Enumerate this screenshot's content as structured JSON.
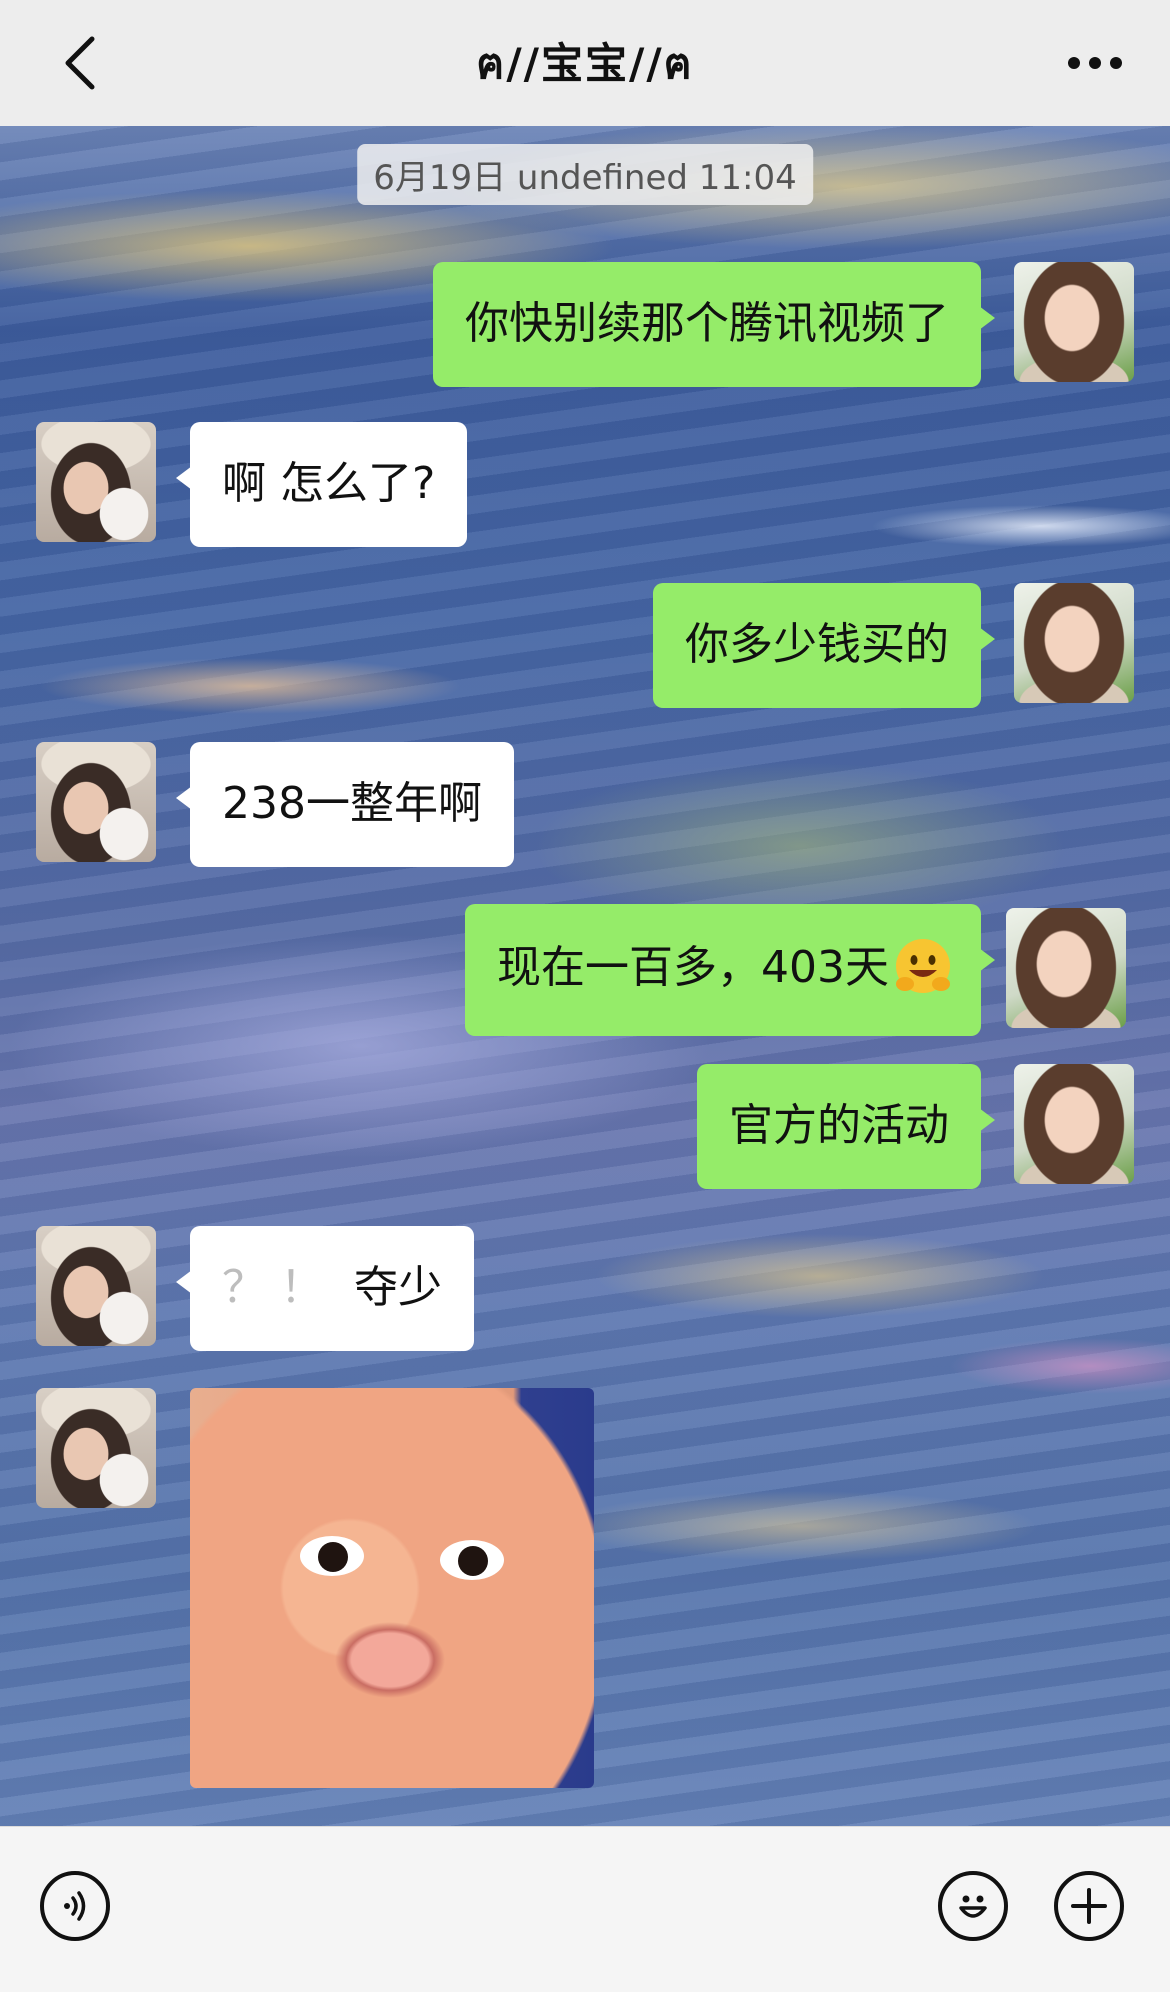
{
  "header": {
    "title": "ฅ//宝宝//ฅ",
    "back_icon": "chevron-left-icon",
    "more_icon": "more-dots-icon"
  },
  "chat": {
    "timestamp": "6月19日 undefined 11:04",
    "messages": [
      {
        "side": "right",
        "type": "text",
        "text": "你快别续那个腾讯视频了"
      },
      {
        "side": "left",
        "type": "text",
        "text": "啊 怎么了?"
      },
      {
        "side": "right",
        "type": "text",
        "text": "你多少钱买的"
      },
      {
        "side": "left",
        "type": "text",
        "text": "238一整年啊"
      },
      {
        "side": "right",
        "type": "text",
        "text": "现在一百多，403天",
        "emoji": "grinning-hands-emoji"
      },
      {
        "side": "right",
        "type": "text",
        "text": "官方的活动"
      },
      {
        "side": "left",
        "type": "text",
        "marks": "？ ！",
        "text": "夺少"
      },
      {
        "side": "left",
        "type": "image",
        "image": "surprised-baby-sticker"
      }
    ]
  },
  "input_bar": {
    "voice_icon": "voice-input-icon",
    "emoji_icon": "emoji-smile-icon",
    "plus_icon": "plus-icon"
  },
  "colors": {
    "sent_bubble": "#95ec69",
    "received_bubble": "#ffffff",
    "header_bg": "#ededed"
  }
}
